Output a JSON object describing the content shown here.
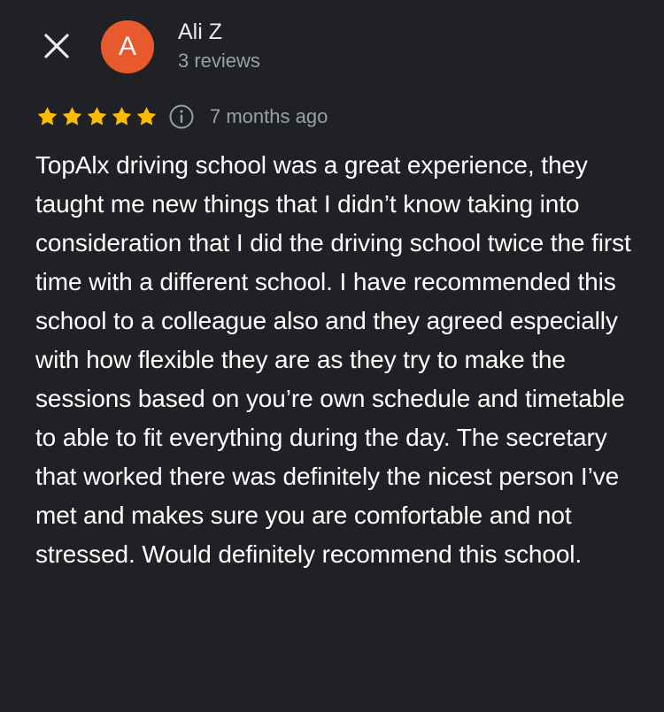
{
  "header": {
    "close_icon": "close-icon",
    "avatar_letter": "A",
    "avatar_color": "#e8592e",
    "user_name": "Ali Z",
    "user_reviews": "3 reviews"
  },
  "review": {
    "rating": 5,
    "rating_max": 5,
    "star_color": "#fbbc04",
    "info_icon": "info-icon",
    "time": "7 months ago",
    "text": "TopAlx driving school was a great experience, they taught me new things that I didn’t know taking into consideration that I did the driving school twice the first time with a different school. I have recommended this school to a colleague also and they agreed especially with how flexible they are as they try to make the sessions based on you’re own schedule and timetable to able to fit everything during the day. The secretary that worked there was definitely the nicest person I’ve met and makes sure you are comfortable and not stressed. Would definitely recommend this school."
  }
}
